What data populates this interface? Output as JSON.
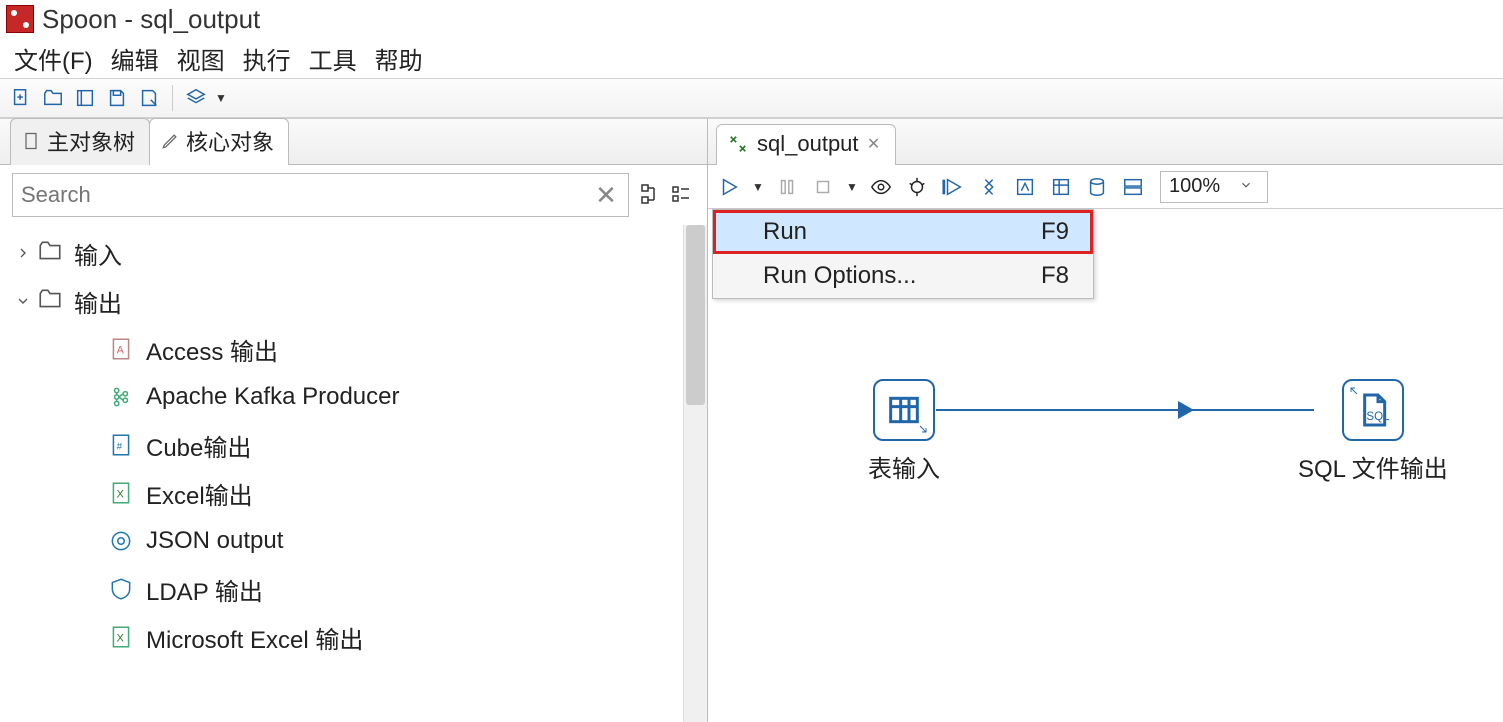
{
  "title": "Spoon - sql_output",
  "menubar": [
    "文件(F)",
    "编辑",
    "视图",
    "执行",
    "工具",
    "帮助"
  ],
  "left": {
    "tabs": {
      "main": "主对象树",
      "core": "核心对象"
    },
    "search_placeholder": "Search",
    "tree": {
      "input_folder": "输入",
      "output_folder": "输出",
      "leaves": [
        "Access 输出",
        "Apache Kafka Producer",
        "Cube输出",
        "Excel输出",
        "JSON output",
        "LDAP 输出",
        "Microsoft Excel 输出"
      ]
    }
  },
  "editor": {
    "tab_label": "sql_output",
    "zoom": "100%",
    "run_menu": {
      "run": {
        "label": "Run",
        "shortcut": "F9"
      },
      "options": {
        "label": "Run Options...",
        "shortcut": "F8"
      }
    },
    "steps": {
      "table_input": "表输入",
      "sql_output": "SQL 文件输出"
    }
  }
}
